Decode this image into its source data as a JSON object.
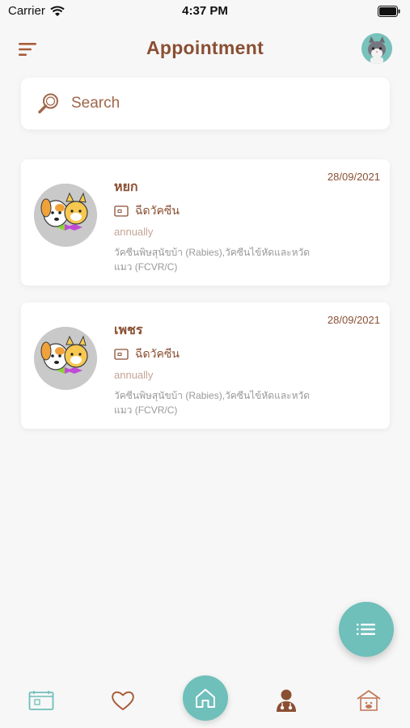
{
  "status_bar": {
    "carrier": "Carrier",
    "time": "4:37 PM"
  },
  "header": {
    "title": "Appointment",
    "menu_icon": "sort-menu-icon",
    "avatar_icon": "cat-avatar-icon"
  },
  "search": {
    "placeholder": "Search",
    "icon": "search-icon"
  },
  "appointments": [
    {
      "pet_name": "หยก",
      "date": "28/09/2021",
      "type": "ฉีดวัคซีน",
      "frequency": "annually",
      "detail": "วัคซีนพิษสุนัขบ้า (Rabies),วัคซีนไข้หัดและหวัดแมว (FCVR/C)"
    },
    {
      "pet_name": "เพชร",
      "date": "28/09/2021",
      "type": "ฉีดวัคซีน",
      "frequency": "annually",
      "detail": "วัคซีนพิษสุนัขบ้า (Rabies),วัคซีนไข้หัดและหวัดแมว (FCVR/C)"
    }
  ],
  "fab": {
    "icon": "list-icon"
  },
  "bottom_nav": [
    {
      "name": "calendar",
      "icon": "calendar-icon"
    },
    {
      "name": "favorite",
      "icon": "heart-icon"
    },
    {
      "name": "home",
      "icon": "home-icon",
      "active": true
    },
    {
      "name": "doctor",
      "icon": "doctor-icon"
    },
    {
      "name": "pet-house",
      "icon": "pet-house-icon"
    }
  ],
  "colors": {
    "brand_brown": "#8a4f33",
    "teal": "#6fbfba",
    "background": "#f7f7f7"
  }
}
